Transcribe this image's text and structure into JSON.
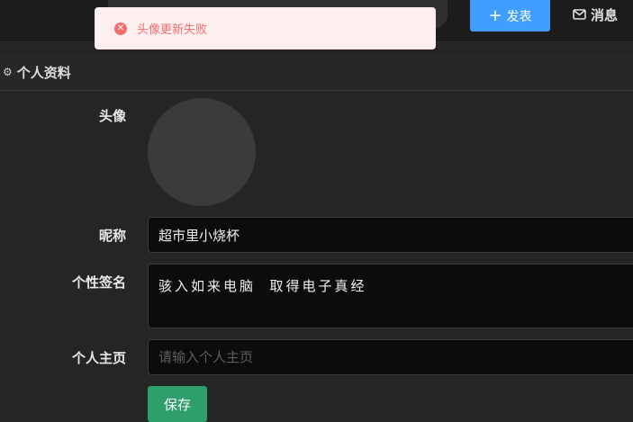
{
  "header": {
    "publish_label": "发表",
    "messages_label": "消息"
  },
  "toast": {
    "message": "头像更新失败",
    "icon": "error-circle-icon",
    "color": "#f56c6c"
  },
  "section": {
    "title": "个人资料",
    "icon": "gear-icon"
  },
  "form": {
    "avatar_label": "头像",
    "nickname_label": "昵称",
    "nickname_value": "超市里小烧杯",
    "signature_label": "个性签名",
    "signature_value": "骇入如来电脑  取得电子真经",
    "homepage_label": "个人主页",
    "homepage_placeholder": "请输入个人主页",
    "save_label": "保存"
  },
  "colors": {
    "primary": "#409eff",
    "success": "#2e9e6b",
    "error": "#f56c6c"
  }
}
